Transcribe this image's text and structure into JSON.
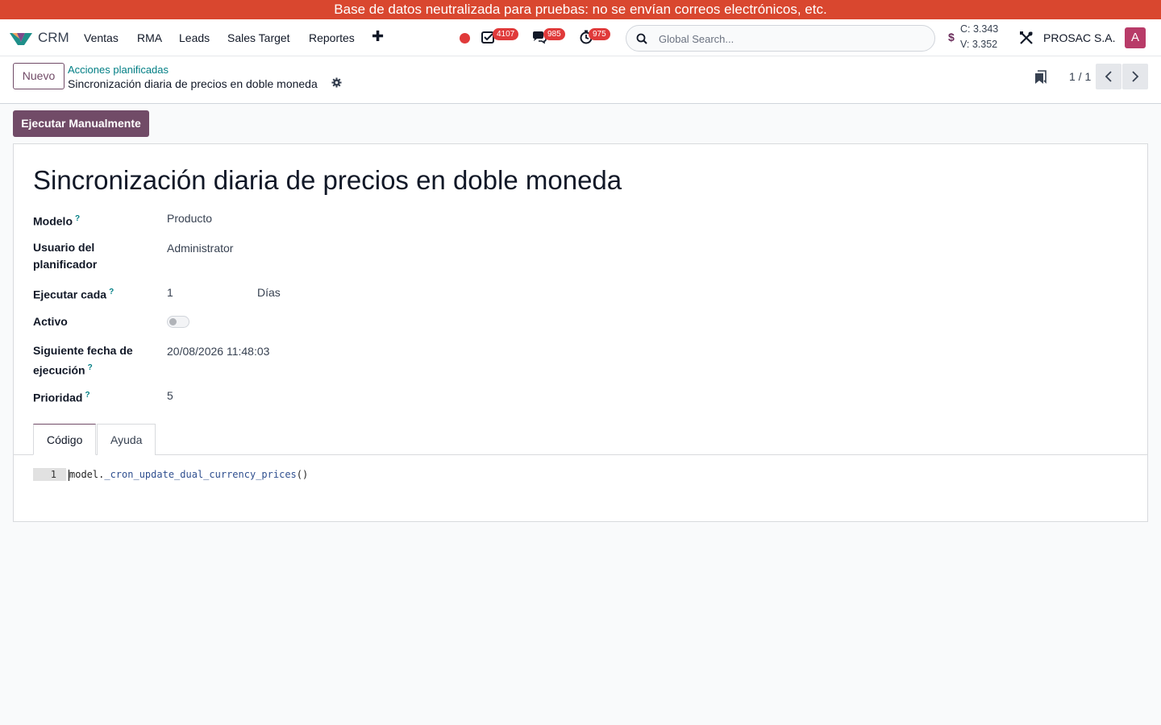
{
  "banner": {
    "text": "Base de datos neutralizada para pruebas: no se envían correos electrónicos, etc."
  },
  "navbar": {
    "app_name": "CRM",
    "menu": [
      "Ventas",
      "RMA",
      "Leads",
      "Sales Target",
      "Reportes"
    ],
    "add_icon": "plus-icon",
    "badges": {
      "activities": "4107",
      "messages": "985",
      "timers": "975"
    },
    "search_placeholder": "Global Search...",
    "currency": {
      "symbol": "$",
      "buy": "C: 3.343",
      "sell": "V: 3.352"
    },
    "company": "PROSAC S.A.",
    "avatar_letter": "A"
  },
  "control_panel": {
    "new_label": "Nuevo",
    "breadcrumb_parent": "Acciones planificadas",
    "breadcrumb_current": "Sincronización diaria de precios en doble moneda",
    "pager": "1 / 1"
  },
  "actions": {
    "run_manually": "Ejecutar Manualmente"
  },
  "record": {
    "title": "Sincronización diaria de precios en doble moneda",
    "fields": {
      "model": {
        "label": "Modelo",
        "value": "Producto"
      },
      "user": {
        "label": "Usuario del planificador",
        "value": "Administrator"
      },
      "interval": {
        "label": "Ejecutar cada",
        "number": "1",
        "unit": "Días"
      },
      "active": {
        "label": "Activo",
        "value": false
      },
      "nextcall": {
        "label": "Siguiente fecha de ejecución",
        "value": "20/08/2026 11:48:03"
      },
      "priority": {
        "label": "Prioridad",
        "value": "5"
      }
    },
    "help_mark": "?"
  },
  "tabs": [
    {
      "label": "Código",
      "active": true
    },
    {
      "label": "Ayuda",
      "active": false
    }
  ],
  "code": {
    "line_number": "1",
    "object": "model",
    "dot": ".",
    "method": "_cron_update_dual_currency_prices",
    "parens": "()"
  },
  "colors": {
    "banner": "#d9472f",
    "primary": "#714b67",
    "link": "#017e84",
    "badge": "#e03a3a"
  }
}
